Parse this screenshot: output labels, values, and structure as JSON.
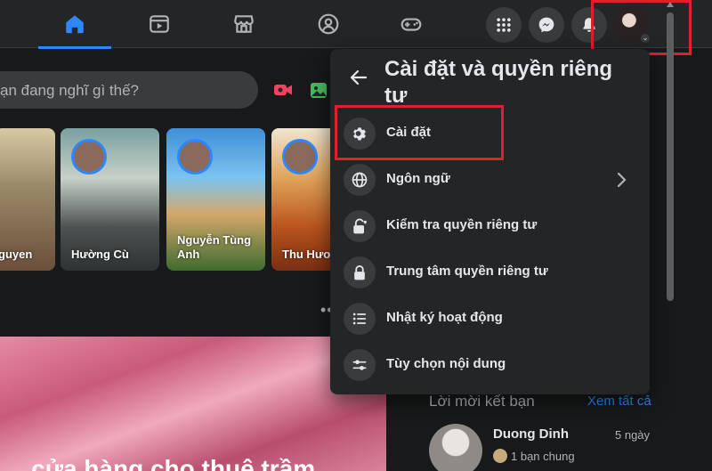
{
  "nav": {
    "tabs": [
      {
        "name": "home-icon",
        "active": true
      },
      {
        "name": "watch-icon",
        "active": false
      },
      {
        "name": "marketplace-icon",
        "active": false
      },
      {
        "name": "groups-icon",
        "active": false
      },
      {
        "name": "gaming-icon",
        "active": false
      }
    ],
    "right_icons": [
      "menu-grid-icon",
      "messenger-icon",
      "notifications-icon"
    ]
  },
  "composer": {
    "placeholder": "ạn đang nghĩ gì thế?"
  },
  "stories": [
    {
      "name": "guyen"
    },
    {
      "name": "Hường Cù"
    },
    {
      "name": "Nguyễn Tùng Anh"
    },
    {
      "name": "Thu Hươn"
    }
  ],
  "post": {
    "caption": "... cửa hàng cho thuê trầm ..."
  },
  "settings_menu": {
    "title": "Cài đặt và quyền riêng tư",
    "items": [
      {
        "label": "Cài đặt",
        "icon": "gear-icon"
      },
      {
        "label": "Ngôn ngữ",
        "icon": "globe-icon"
      },
      {
        "label": "Kiểm tra quyền riêng tư",
        "icon": "privacy-checkup-icon"
      },
      {
        "label": "Trung tâm quyền riêng tư",
        "icon": "lock-icon"
      },
      {
        "label": "Nhật ký hoạt động",
        "icon": "list-icon"
      },
      {
        "label": "Tùy chọn nội dung",
        "icon": "sliders-icon"
      }
    ]
  },
  "friend_requests": {
    "title": "Lời mời kết bạn",
    "see_all": "Xem tất cả",
    "items": [
      {
        "name": "Duong Dinh",
        "time": "5 ngày",
        "mutual": "1 bạn chung"
      }
    ]
  },
  "colors": {
    "accent": "#2d88ff",
    "highlight_box": "#e0202a",
    "background": "#18191a",
    "surface": "#242526"
  }
}
